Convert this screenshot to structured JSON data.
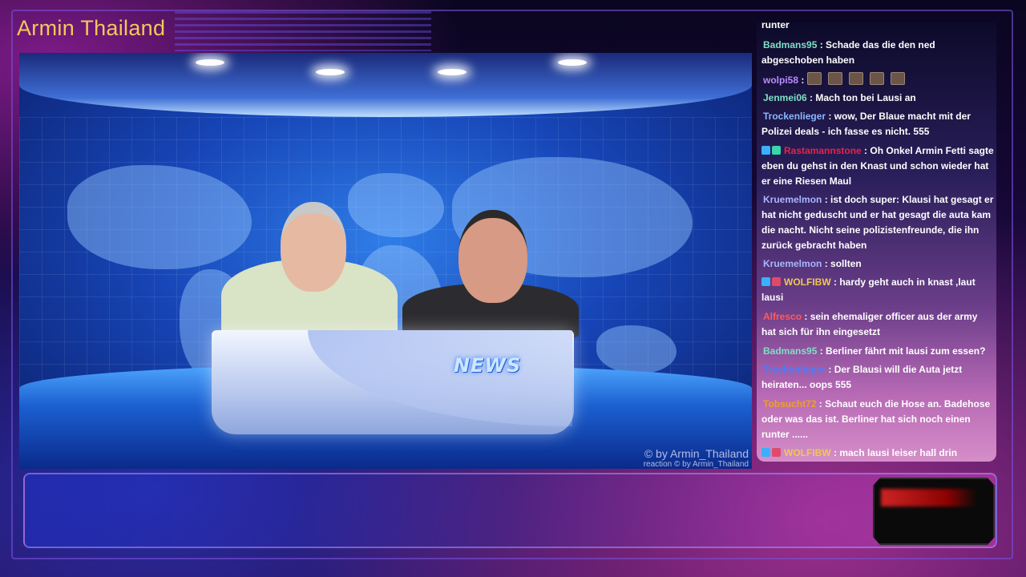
{
  "overlay": {
    "channel_title": "Armin Thailand"
  },
  "video": {
    "desk_logo": "NEWS",
    "watermark_main": "© by Armin_Thailand",
    "watermark_sub": "reaction  © by Armin_Thailand"
  },
  "chat": {
    "truncated_top": "runter",
    "messages": [
      {
        "user": "Badmans95",
        "color": "#7ee0c4",
        "text": ": Schade das die den ned abgeschoben haben",
        "badges": []
      },
      {
        "user": "wolpi58",
        "color": "#b98bff",
        "text": ":",
        "badges": [],
        "emotes": 5
      },
      {
        "user": "Jenmei06",
        "color": "#7ee0c4",
        "text": ": Mach ton bei Lausi an",
        "badges": []
      },
      {
        "user": "Trockenlieger",
        "color": "#8ab8ff",
        "text": ": wow, Der Blaue macht mit der Polizei deals - ich fasse es nicht. 555",
        "badges": []
      },
      {
        "user": "Rastamannstone",
        "color": "#e8224a",
        "text": ": Oh Onkel Armin Fetti sagte eben du gehst in den Knast und schon wieder hat er eine Riesen Maul",
        "badges": [
          "#3ab0ff",
          "#38d6a8"
        ]
      },
      {
        "user": "Kruemelmon",
        "color": "#a9b6ff",
        "text": ": ist doch super: Klausi hat gesagt er hat nicht geduscht und er hat gesagt die auta kam die nacht. Nicht seine polizistenfreunde, die ihn zurück gebracht haben",
        "badges": []
      },
      {
        "user": "Kruemelmon",
        "color": "#a9b6ff",
        "text": ": sollten",
        "badges": []
      },
      {
        "user": "WOLFIBW",
        "color": "#f0c850",
        "text": ": hardy geht auch in knast ,laut lausi",
        "badges": [
          "#3ab0ff",
          "#e04a6a"
        ]
      },
      {
        "user": "Alfresco",
        "color": "#ff5a5a",
        "text": ": sein ehemaliger officer aus der army hat sich für ihn eingesetzt",
        "badges": []
      },
      {
        "user": "Badmans95",
        "color": "#7ee0c4",
        "text": ": Berliner fährt mit lausi zum essen?",
        "badges": []
      },
      {
        "user": "Trockenlieger",
        "color": "#4a7cff",
        "text": ": Der Blausi will die Auta jetzt heiraten... oops 555",
        "badges": []
      },
      {
        "user": "Tobsucht72",
        "color": "#f0a020",
        "text": ": Schaut euch die Hose an. Badehose oder was das ist. Berliner hat sich noch einen runter ......",
        "badges": []
      },
      {
        "user": "WOLFIBW",
        "color": "#f0c850",
        "text": ": mach lausi leiser hall drin",
        "badges": [
          "#3ab0ff",
          "#e04a6a"
        ]
      }
    ]
  }
}
